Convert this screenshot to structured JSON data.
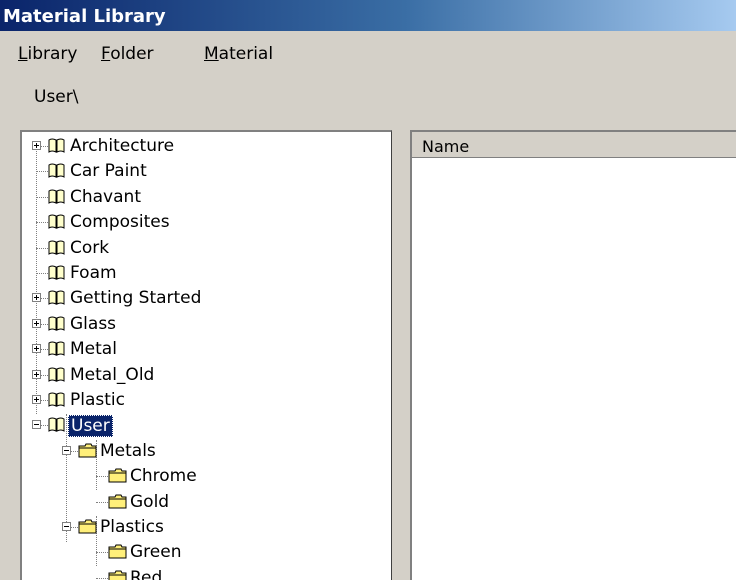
{
  "window": {
    "title": "Material Library"
  },
  "menubar": [
    {
      "accel": "L",
      "rest": "ibrary"
    },
    {
      "accel": "F",
      "rest": "older"
    },
    {
      "accel": "M",
      "rest": "aterial"
    }
  ],
  "path": "User\\",
  "tree": {
    "items": [
      {
        "label": "Architecture",
        "icon": "book-icon",
        "expander": "plus"
      },
      {
        "label": "Car Paint",
        "icon": "book-icon",
        "expander": "none"
      },
      {
        "label": "Chavant",
        "icon": "book-icon",
        "expander": "none"
      },
      {
        "label": "Composites",
        "icon": "book-icon",
        "expander": "none"
      },
      {
        "label": "Cork",
        "icon": "book-icon",
        "expander": "none"
      },
      {
        "label": "Foam",
        "icon": "book-icon",
        "expander": "none"
      },
      {
        "label": "Getting Started",
        "icon": "book-icon",
        "expander": "plus"
      },
      {
        "label": "Glass",
        "icon": "book-icon",
        "expander": "plus"
      },
      {
        "label": "Metal",
        "icon": "book-icon",
        "expander": "plus"
      },
      {
        "label": "Metal_Old",
        "icon": "book-icon",
        "expander": "plus"
      },
      {
        "label": "Plastic",
        "icon": "book-icon",
        "expander": "plus"
      },
      {
        "label": "User",
        "icon": "book-icon",
        "expander": "minus",
        "selected": true
      },
      {
        "label": "Metals",
        "icon": "folder-icon",
        "expander": "minus"
      },
      {
        "label": "Chrome",
        "icon": "folder-icon",
        "expander": "none"
      },
      {
        "label": "Gold",
        "icon": "folder-icon",
        "expander": "none"
      },
      {
        "label": "Plastics",
        "icon": "folder-icon",
        "expander": "minus"
      },
      {
        "label": "Green",
        "icon": "folder-icon",
        "expander": "none"
      },
      {
        "label": "Red",
        "icon": "folder-icon",
        "expander": "none"
      }
    ]
  },
  "listview": {
    "column_name": "Name"
  },
  "colors": {
    "title_start": "#0a246a",
    "title_end": "#a6caf0",
    "selection": "#0a246a"
  }
}
